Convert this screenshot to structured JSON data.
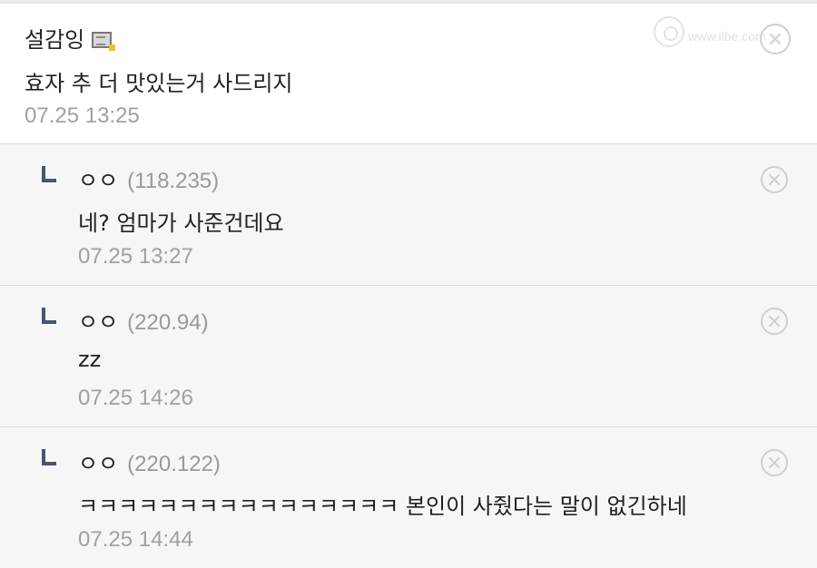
{
  "watermark": {
    "text": "www.ilbe.com"
  },
  "comment": {
    "author": "설감잉",
    "author_icon": "memo-icon",
    "text": "효자 추 더 맛있는거 사드리지",
    "timestamp": "07.25 13:25",
    "delete_icon": "close-circle-icon"
  },
  "replies": [
    {
      "author": "ㅇㅇ",
      "ip": "(118.235)",
      "text": "네? 엄마가 사준건데요",
      "timestamp": "07.25 13:27"
    },
    {
      "author": "ㅇㅇ",
      "ip": "(220.94)",
      "text": "zz",
      "timestamp": "07.25 14:26"
    },
    {
      "author": "ㅇㅇ",
      "ip": "(220.122)",
      "text": "ㅋㅋㅋㅋㅋㅋㅋㅋㅋㅋㅋㅋㅋㅋㅋㅋ 본인이 사줬다는 말이 없긴하네",
      "timestamp": "07.25 14:44"
    }
  ],
  "colors": {
    "reply_background": "#f6f6f6",
    "reply_arrow": "#4a5372",
    "meta_text": "#a0a0a0"
  }
}
